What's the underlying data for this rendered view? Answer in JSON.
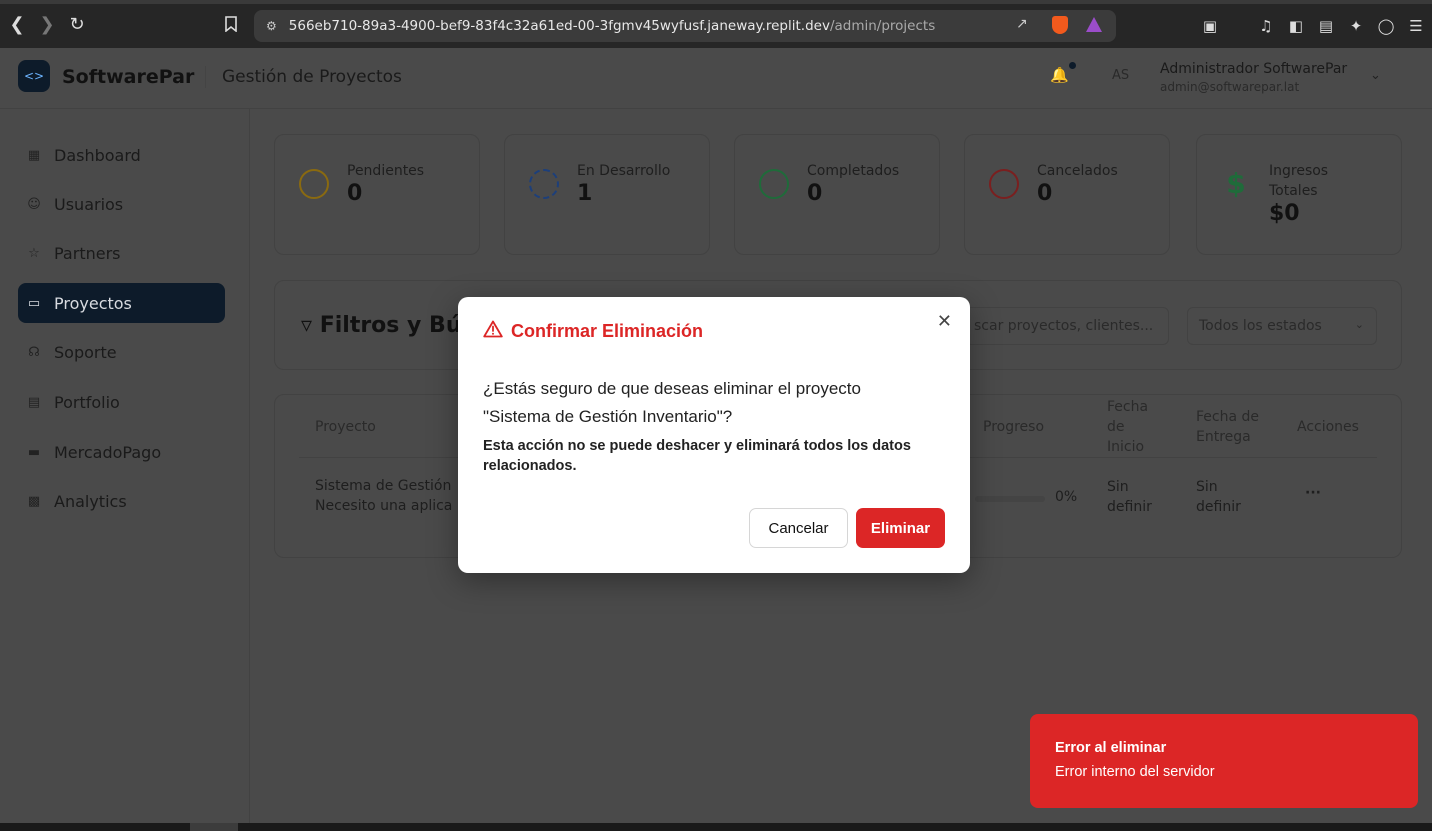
{
  "browser": {
    "url_host": "566eb710-89a3-4900-bef9-83f4c32a61ed-00-3fgmv45wyfusf.janeway.replit.dev",
    "url_path": "/admin/projects"
  },
  "header": {
    "brand": "SoftwarePar",
    "section": "Gestión de Proyectos",
    "avatar_initials": "AS",
    "user_name": "Administrador SoftwarePar",
    "user_email": "admin@softwarepar.lat"
  },
  "sidebar": {
    "items": [
      {
        "label": "Dashboard",
        "icon": "grid-icon"
      },
      {
        "label": "Usuarios",
        "icon": "users-icon"
      },
      {
        "label": "Partners",
        "icon": "handshake-icon"
      },
      {
        "label": "Proyectos",
        "icon": "folder-icon",
        "active": true
      },
      {
        "label": "Soporte",
        "icon": "headset-icon"
      },
      {
        "label": "Portfolio",
        "icon": "document-icon"
      },
      {
        "label": "MercadoPago",
        "icon": "card-icon"
      },
      {
        "label": "Analytics",
        "icon": "bar-chart-icon"
      }
    ]
  },
  "stats": [
    {
      "label": "Pendientes",
      "value": "0",
      "icon": "clock-icon",
      "color": "#8a6a10"
    },
    {
      "label": "En Desarrollo",
      "value": "1",
      "icon": "gear-icon",
      "color": "#1d3f7a"
    },
    {
      "label": "Completados",
      "value": "0",
      "icon": "check-circle-icon",
      "color": "#1f6b3a"
    },
    {
      "label": "Cancelados",
      "value": "0",
      "icon": "x-circle-icon",
      "color": "#7a1f1f"
    },
    {
      "label": "Ingresos Totales",
      "value": "$0",
      "icon": "dollar-icon",
      "color": "#1f6b3a"
    }
  ],
  "filters": {
    "title": "Filtros y Bús",
    "search_placeholder": "scar proyectos, clientes...",
    "status_value": "Todos los estados"
  },
  "table": {
    "headers": {
      "project": "Proyecto",
      "progress": "Progreso",
      "start": "Fecha de Inicio",
      "due": "Fecha de Entrega",
      "actions": "Acciones"
    },
    "row": {
      "name": "Sistema de Gestión",
      "desc": "Necesito una aplica",
      "progress": "0%",
      "start": "Sin definir",
      "due": "Sin definir",
      "actions": "···"
    }
  },
  "modal": {
    "title": "Confirmar Eliminación",
    "message": "¿Estás seguro de que deseas eliminar el proyecto \"Sistema de Gestión Inventario\"?",
    "note": "Esta acción no se puede deshacer y eliminará todos los datos relacionados.",
    "cancel_label": "Cancelar",
    "delete_label": "Eliminar",
    "close_glyph": "✕",
    "accent": "#dc2626"
  },
  "toast": {
    "title": "Error al eliminar",
    "description": "Error interno del servidor",
    "color": "#dc2626"
  }
}
